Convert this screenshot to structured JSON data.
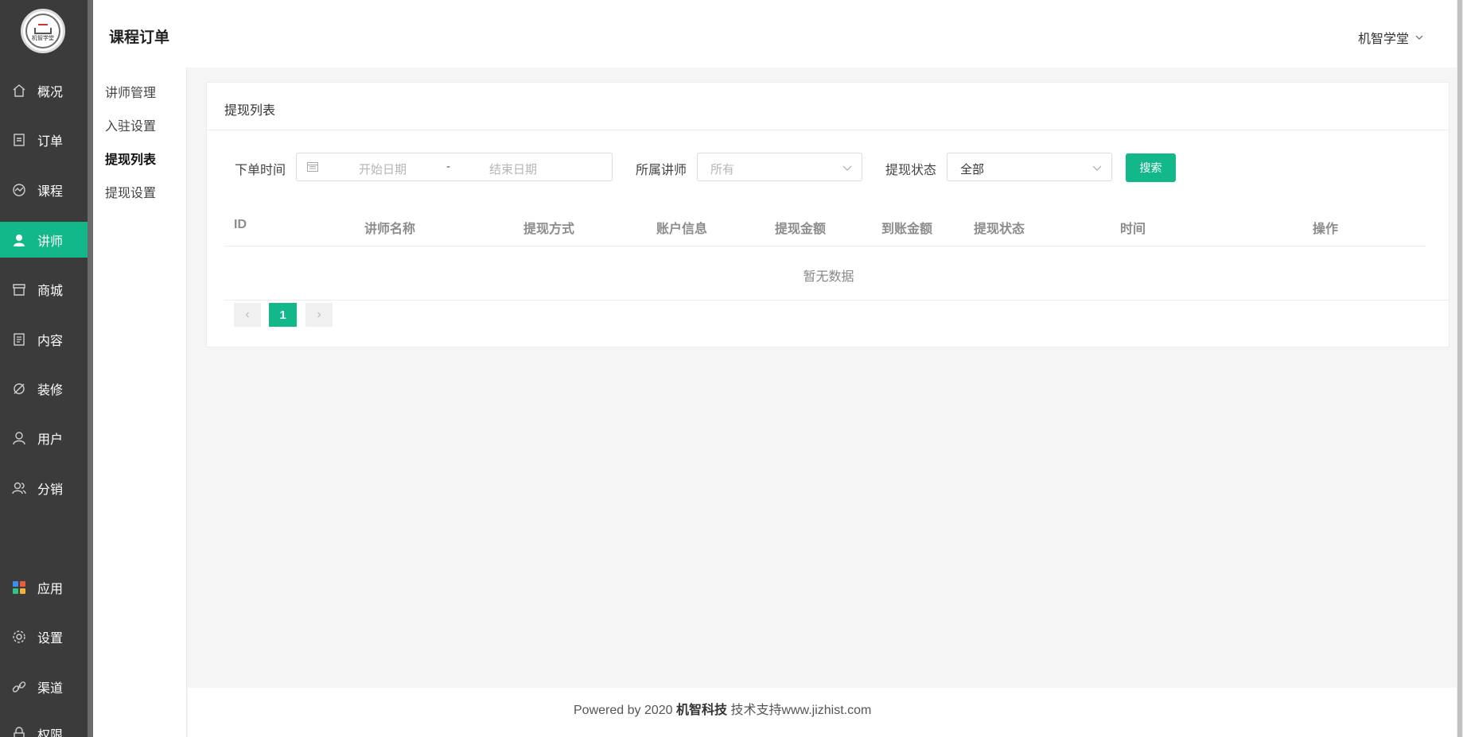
{
  "app": {
    "logo_text": "机智学堂"
  },
  "sidebar": {
    "items": [
      {
        "label": "概况",
        "icon": "home-icon"
      },
      {
        "label": "订单",
        "icon": "order-icon"
      },
      {
        "label": "课程",
        "icon": "course-icon"
      },
      {
        "label": "讲师",
        "icon": "teacher-icon",
        "active": true
      },
      {
        "label": "商城",
        "icon": "shop-icon"
      },
      {
        "label": "内容",
        "icon": "content-icon"
      },
      {
        "label": "装修",
        "icon": "decorate-icon"
      },
      {
        "label": "用户",
        "icon": "user-icon"
      },
      {
        "label": "分销",
        "icon": "distribution-icon"
      },
      {
        "label": "应用",
        "icon": "apps-icon"
      },
      {
        "label": "设置",
        "icon": "gear-icon"
      },
      {
        "label": "渠道",
        "icon": "link-icon"
      },
      {
        "label": "权限",
        "icon": "lock-icon"
      }
    ]
  },
  "header": {
    "title": "课程订单",
    "user": "机智学堂"
  },
  "submenu": {
    "items": [
      {
        "label": "讲师管理"
      },
      {
        "label": "入驻设置"
      },
      {
        "label": "提现列表",
        "active": true
      },
      {
        "label": "提现设置"
      }
    ]
  },
  "card": {
    "title": "提现列表",
    "filters": {
      "order_time_label": "下单时间",
      "start_placeholder": "开始日期",
      "separator": "-",
      "end_placeholder": "结束日期",
      "teacher_label": "所属讲师",
      "teacher_value": "所有",
      "status_label": "提现状态",
      "status_value": "全部",
      "search_button": "搜索"
    },
    "table": {
      "columns": [
        "ID",
        "讲师名称",
        "提现方式",
        "账户信息",
        "提现金额",
        "到账金额",
        "提现状态",
        "时间",
        "操作"
      ],
      "rows": [],
      "empty_text": "暂无数据"
    },
    "pagination": {
      "current_page": "1",
      "prev": "‹",
      "next": "›"
    }
  },
  "footer": {
    "prefix": "Powered by 2020 ",
    "company": "机智科技",
    "suffix": " 技术支持www.jizhist.com"
  },
  "colors": {
    "accent": "#13b88a",
    "sidebar_bg": "#3b3b3b"
  }
}
